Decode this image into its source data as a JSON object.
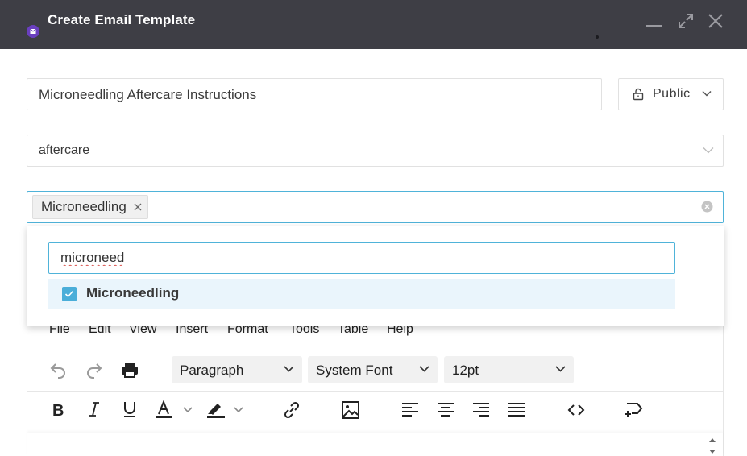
{
  "window": {
    "title": "Create Email Template",
    "icon": "email-icon",
    "controls": [
      "minimize-icon",
      "maximize-icon",
      "close-icon"
    ]
  },
  "form": {
    "template_name": "Microneedling Aftercare Instructions",
    "visibility": {
      "label": "Public",
      "icon": "lock-icon"
    },
    "category": {
      "value": "aftercare"
    },
    "tags": [
      {
        "label": "Microneedling"
      }
    ]
  },
  "tag_dropdown": {
    "search_value": "microneed",
    "options": [
      {
        "label": "Microneedling",
        "checked": true
      }
    ]
  },
  "editor": {
    "menu": [
      "File",
      "Edit",
      "View",
      "Insert",
      "Format",
      "Tools",
      "Table",
      "Help"
    ],
    "block_format": "Paragraph",
    "font_family": "System Font",
    "font_size": "12pt",
    "toolbar_row2_icons": [
      "bold-icon",
      "italic-icon",
      "underline-icon",
      "text-color-icon",
      "highlight-color-icon",
      "link-icon",
      "image-icon",
      "align-left-icon",
      "align-center-icon",
      "align-right-icon",
      "justify-icon",
      "source-code-icon",
      "insert-placeholder-icon"
    ]
  },
  "colors": {
    "titlebar": "#3e3e45",
    "accent": "#4fb3d9",
    "app_icon": "#6a3fbf",
    "option_highlight": "#eaf5fc"
  }
}
